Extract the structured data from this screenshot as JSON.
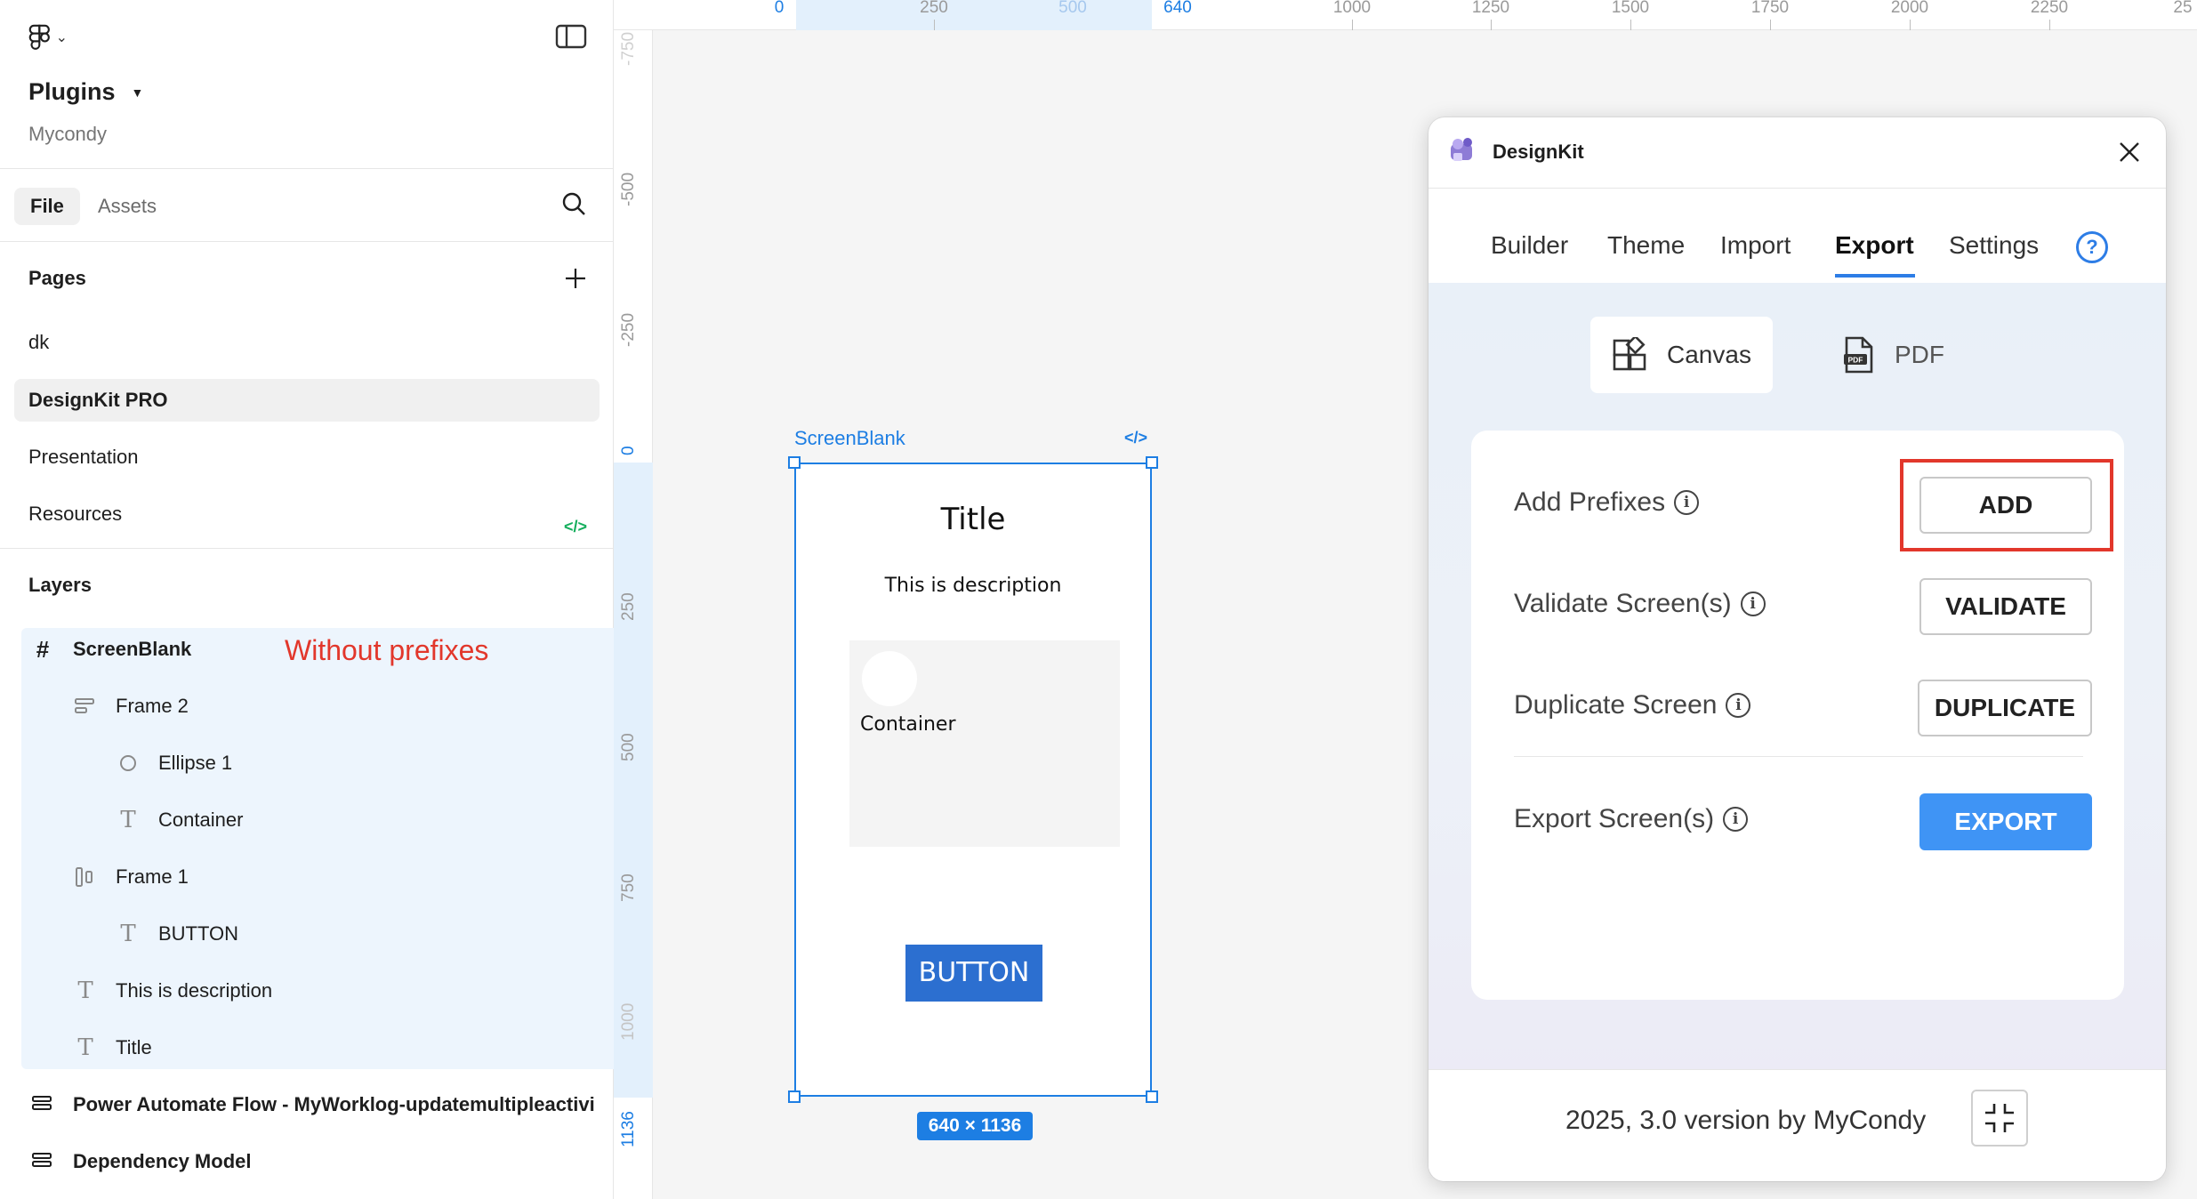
{
  "sidebar": {
    "file_name": "Plugins",
    "team_name": "Mycondy",
    "tabs": {
      "file": "File",
      "assets": "Assets"
    },
    "pages_header": "Pages",
    "pages": [
      {
        "label": "dk"
      },
      {
        "label": "DesignKit PRO"
      },
      {
        "label": "Presentation"
      },
      {
        "label": "Resources"
      }
    ],
    "layers_header": "Layers",
    "layers": [
      {
        "label": "ScreenBlank"
      },
      {
        "label": "Frame 2"
      },
      {
        "label": "Ellipse 1"
      },
      {
        "label": "Container"
      },
      {
        "label": "Frame 1"
      },
      {
        "label": "BUTTON"
      },
      {
        "label": "This is description"
      },
      {
        "label": "Title"
      },
      {
        "label": "Power Automate Flow - MyWorklog-updatemultipleactivi"
      },
      {
        "label": "Dependency Model"
      }
    ],
    "annotation": "Without prefixes"
  },
  "rulers": {
    "top": [
      "0",
      "250",
      "500",
      "640",
      "1000",
      "1250",
      "1500",
      "1750",
      "2000",
      "2250",
      "25"
    ],
    "left": [
      "-750",
      "-500",
      "-250",
      "0",
      "250",
      "500",
      "750",
      "1000",
      "1136"
    ]
  },
  "canvas": {
    "frame_name": "ScreenBlank",
    "frame_size": "640 × 1136",
    "title": "Title",
    "description": "This is description",
    "container_text": "Container",
    "button_text": "BUTTON"
  },
  "plugin": {
    "name": "DesignKit",
    "tabs": [
      "Builder",
      "Theme",
      "Import",
      "Export",
      "Settings"
    ],
    "active_tab": "Export",
    "help": "?",
    "modes": {
      "canvas": "Canvas",
      "pdf": "PDF"
    },
    "actions": [
      {
        "label": "Add Prefixes",
        "button": "ADD"
      },
      {
        "label": "Validate Screen(s)",
        "button": "VALIDATE"
      },
      {
        "label": "Duplicate Screen",
        "button": "DUPLICATE"
      },
      {
        "label": "Export Screen(s)",
        "button": "EXPORT"
      }
    ],
    "info_glyph": "i",
    "footer": "2025, 3.0 version by MyCondy"
  },
  "colors": {
    "accent": "#1d7ee3",
    "annotation_red": "#e2372b",
    "export_button": "#3f94f5",
    "frame_button": "#2c6fd0",
    "resources_icon": "#14ae5c"
  },
  "icons": {
    "main_menu": "figma-logo-icon",
    "panel": "sidebar-toggle-icon",
    "search": "search-icon",
    "add_page": "plus-icon",
    "dev_mode": "code-icon",
    "frame": "hash-icon",
    "auto_layout": "auto-layout-icon",
    "ellipse": "ellipse-icon",
    "text": "text-icon",
    "close": "close-icon",
    "canvas": "canvas-icon",
    "pdf": "pdf-icon",
    "collapse": "collapse-icon"
  }
}
